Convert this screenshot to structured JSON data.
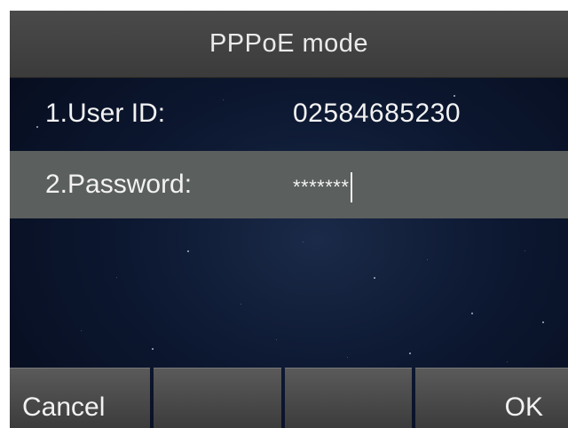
{
  "title": "PPPoE mode",
  "fields": [
    {
      "label": "1.User ID:",
      "value": "02584685230"
    },
    {
      "label": "2.Password:",
      "value": "*******"
    }
  ],
  "softkeys": [
    "Cancel",
    "",
    "",
    "OK"
  ],
  "colors": {
    "title_bar": "#444444",
    "selected_row": "#5b5f5d",
    "background": "#0c1730",
    "text": "#f2f2f2"
  }
}
